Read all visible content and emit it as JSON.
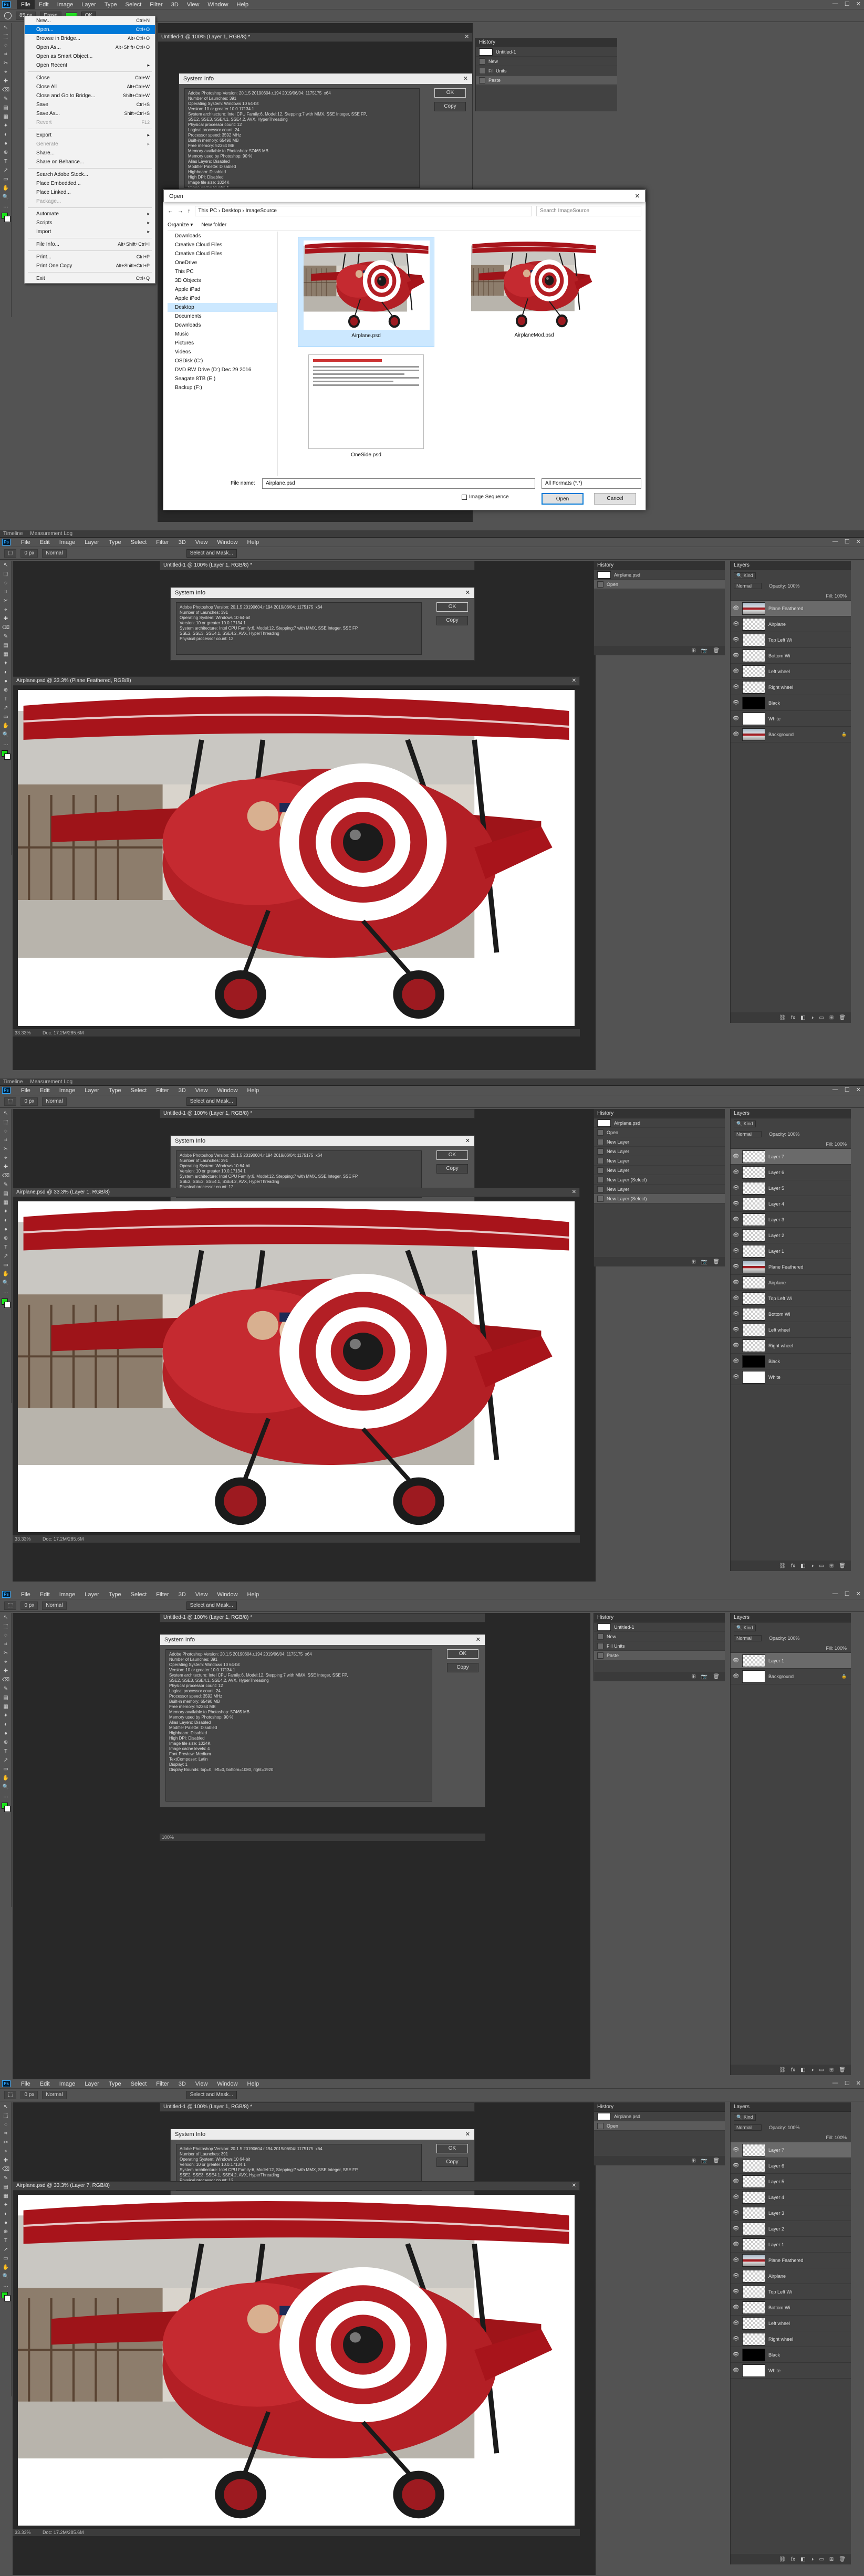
{
  "app": {
    "menu": [
      "File",
      "Edit",
      "Image",
      "Layer",
      "Type",
      "Select",
      "Filter",
      "3D",
      "View",
      "Window",
      "Help"
    ],
    "window_controls": [
      "—",
      "☐",
      "✕"
    ],
    "logo": "Ps"
  },
  "separator_tabs": [
    "Timeline",
    "Measurement Log"
  ],
  "panel1": {
    "options": {
      "zoom": "85 px",
      "mode": "Erase",
      "ok": "OK"
    },
    "doc_tab": "Untitled-1 @ 100% (Layer 1, RGB/8) *",
    "file_menu": [
      {
        "label": "New...",
        "shortcut": "Ctrl+N"
      },
      {
        "label": "Open...",
        "shortcut": "Ctrl+O",
        "hl": true
      },
      {
        "label": "Browse in Bridge...",
        "shortcut": "Alt+Ctrl+O"
      },
      {
        "label": "Open As...",
        "shortcut": "Alt+Shift+Ctrl+O"
      },
      {
        "label": "Open as Smart Object...",
        "shortcut": ""
      },
      {
        "label": "Open Recent",
        "shortcut": "▸"
      },
      {
        "sep": true
      },
      {
        "label": "Close",
        "shortcut": "Ctrl+W"
      },
      {
        "label": "Close All",
        "shortcut": "Alt+Ctrl+W"
      },
      {
        "label": "Close and Go to Bridge...",
        "shortcut": "Shift+Ctrl+W"
      },
      {
        "label": "Save",
        "shortcut": "Ctrl+S"
      },
      {
        "label": "Save As...",
        "shortcut": "Shift+Ctrl+S"
      },
      {
        "label": "Revert",
        "shortcut": "F12",
        "dis": true
      },
      {
        "sep": true
      },
      {
        "label": "Export",
        "shortcut": "▸"
      },
      {
        "label": "Generate",
        "shortcut": "▸",
        "dis": true
      },
      {
        "label": "Share...",
        "shortcut": ""
      },
      {
        "label": "Share on Behance...",
        "shortcut": ""
      },
      {
        "sep": true
      },
      {
        "label": "Search Adobe Stock...",
        "shortcut": ""
      },
      {
        "label": "Place Embedded...",
        "shortcut": ""
      },
      {
        "label": "Place Linked...",
        "shortcut": ""
      },
      {
        "label": "Package...",
        "shortcut": "",
        "dis": true
      },
      {
        "sep": true
      },
      {
        "label": "Automate",
        "shortcut": "▸"
      },
      {
        "label": "Scripts",
        "shortcut": "▸"
      },
      {
        "label": "Import",
        "shortcut": "▸"
      },
      {
        "sep": true
      },
      {
        "label": "File Info...",
        "shortcut": "Alt+Shift+Ctrl+I"
      },
      {
        "sep": true
      },
      {
        "label": "Print...",
        "shortcut": "Ctrl+P"
      },
      {
        "label": "Print One Copy",
        "shortcut": "Alt+Shift+Ctrl+P"
      },
      {
        "sep": true
      },
      {
        "label": "Exit",
        "shortcut": "Ctrl+Q"
      }
    ],
    "history": {
      "header": "History",
      "rows": [
        "Untitled-1",
        "New",
        "Fill Units",
        "Paste"
      ]
    },
    "open_dialog": {
      "title": "Open",
      "path": "This PC  ›  Desktop  ›  ImageSource",
      "search": "Search ImageSource",
      "organize": "Organize ▾",
      "new_folder": "New folder",
      "nav": [
        "Downloads",
        "Creative Cloud Files",
        "Creative Cloud Files",
        "OneDrive",
        "This PC",
        "3D Objects",
        "Apple iPad",
        "Apple iPod",
        "Desktop",
        "Documents",
        "Downloads",
        "Music",
        "Pictures",
        "Videos",
        "OSDisk (C:)",
        "DVD RW Drive (D:) Dec 29 2016",
        "Seagate 8TB (E:)",
        "Backup (F:)"
      ],
      "nav_selected": 8,
      "files": [
        "Airplane.psd",
        "AirplaneMod.psd",
        "OneSide.psd"
      ],
      "file_name_label": "File name:",
      "file_name_value": "Airplane.psd",
      "format": "All Formats (*.*)",
      "image_sequence": "Image Sequence",
      "open_btn": "Open",
      "cancel_btn": "Cancel"
    }
  },
  "sysinfo": {
    "title": "System Info",
    "ok": "OK",
    "copy": "Copy",
    "text": "Adobe Photoshop Version: 20.1.5 20190604.r.194 2019/06/04: 1175175  x64\nNumber of Launches: 391\nOperating System: Windows 10 64-bit\nVersion: 10 or greater 10.0.17134.1\nSystem architecture: Intel CPU Family:6, Model:12, Stepping:7 with MMX, SSE Integer, SSE FP,\nSSE2, SSE3, SSE4.1, SSE4.2, AVX, HyperThreading\nPhysical processor count: 12\nLogical processor count: 24\nProcessor speed: 3592 MHz\nBuilt-in memory: 65490 MB\nFree memory: 52354 MB\nMemory available to Photoshop: 57465 MB\nMemory used by Photoshop: 90 %\nAlias Layers: Disabled\nModifier Palette: Disabled\nHighbeam: Disabled\nHigh DPI: Disabled\nImage tile size: 1024K\nImage cache levels: 4\nFont Preview: Medium\nTextComposer: Latin\nDisplay: 1\nDisplay Bounds: top=0, left=0, bottom=1080, right=1920",
    "zoom": "100%"
  },
  "panel2": {
    "options": {
      "feather": "0 px",
      "style": "Normal",
      "select_mask": "Select and Mask..."
    },
    "doc_tab": "Airplane.psd @ 33.3% (Plane Feathered, RGB/8)",
    "status_zoom": "33.33%",
    "status_doc": "Doc: 17.2M/285.6M",
    "history": {
      "header": "History",
      "doc": "Airplane.psd",
      "rows": [
        "Open"
      ]
    },
    "layers": {
      "header": "Layers",
      "kind": "Kind",
      "blend": "Normal",
      "opacity": "Opacity: 100%",
      "fill": "Fill: 100%",
      "rows": [
        {
          "name": "Plane Feathered",
          "thumb": "photo",
          "sel": true
        },
        {
          "name": "Airplane",
          "thumb": "trans"
        },
        {
          "name": "Top Left Wi",
          "thumb": "trans"
        },
        {
          "name": "Bottom Wi",
          "thumb": "trans"
        },
        {
          "name": "Left wheel",
          "thumb": "trans"
        },
        {
          "name": "Right wheel",
          "thumb": "trans"
        },
        {
          "name": "Black",
          "thumb": "black"
        },
        {
          "name": "White",
          "thumb": "white"
        },
        {
          "name": "Background",
          "thumb": "photo"
        }
      ]
    }
  },
  "panel3": {
    "doc_tab": "Airplane.psd @ 33.3% (Layer 1, RGB/8)",
    "status_zoom": "33.33%",
    "status_doc": "Doc: 17.2M/285.6M",
    "history": {
      "header": "History",
      "doc": "Airplane.psd",
      "rows": [
        "Open",
        "New Layer",
        "New Layer",
        "New Layer",
        "New Layer",
        "New Layer (Select)",
        "New Layer",
        "New Layer (Select)"
      ]
    },
    "layers": {
      "header": "Layers",
      "rows": [
        {
          "name": "Layer 7",
          "thumb": "trans",
          "sel": true
        },
        {
          "name": "Layer 6",
          "thumb": "trans"
        },
        {
          "name": "Layer 5",
          "thumb": "trans"
        },
        {
          "name": "Layer 4",
          "thumb": "trans"
        },
        {
          "name": "Layer 3",
          "thumb": "trans"
        },
        {
          "name": "Layer 2",
          "thumb": "trans"
        },
        {
          "name": "Layer 1",
          "thumb": "trans"
        },
        {
          "name": "Plane Feathered",
          "thumb": "photo"
        },
        {
          "name": "Airplane",
          "thumb": "trans"
        },
        {
          "name": "Top Left Wi",
          "thumb": "trans"
        },
        {
          "name": "Bottom Wi",
          "thumb": "trans"
        },
        {
          "name": "Left wheel",
          "thumb": "trans"
        },
        {
          "name": "Right wheel",
          "thumb": "trans"
        },
        {
          "name": "Black",
          "thumb": "black"
        },
        {
          "name": "White",
          "thumb": "white"
        }
      ]
    }
  },
  "panel4": {
    "history": {
      "header": "History",
      "doc": "Untitled-1",
      "rows": [
        "New",
        "Fill Units",
        "Paste"
      ]
    },
    "layers": {
      "header": "Layers",
      "rows": [
        {
          "name": "Layer 1",
          "thumb": "trans",
          "sel": true
        },
        {
          "name": "Background",
          "thumb": "white"
        }
      ]
    }
  },
  "panel5": {
    "doc_tab": "Airplane.psd @ 33.3% (Layer 7, RGB/8)",
    "status_zoom": "33.33%",
    "status_doc": "Doc: 17.2M/285.6M",
    "history": {
      "header": "History",
      "doc": "Airplane.psd",
      "rows": [
        "Open"
      ]
    },
    "layers": {
      "header": "Layers",
      "rows": [
        {
          "name": "Layer 7",
          "thumb": "trans",
          "sel": true
        },
        {
          "name": "Layer 6",
          "thumb": "trans"
        },
        {
          "name": "Layer 5",
          "thumb": "trans"
        },
        {
          "name": "Layer 4",
          "thumb": "trans"
        },
        {
          "name": "Layer 3",
          "thumb": "trans"
        },
        {
          "name": "Layer 2",
          "thumb": "trans"
        },
        {
          "name": "Layer 1",
          "thumb": "trans"
        },
        {
          "name": "Plane Feathered",
          "thumb": "photo"
        },
        {
          "name": "Airplane",
          "thumb": "trans"
        },
        {
          "name": "Top Left Wi",
          "thumb": "trans"
        },
        {
          "name": "Bottom Wi",
          "thumb": "trans"
        },
        {
          "name": "Left wheel",
          "thumb": "trans"
        },
        {
          "name": "Right wheel",
          "thumb": "trans"
        },
        {
          "name": "Black",
          "thumb": "black"
        },
        {
          "name": "White",
          "thumb": "white"
        }
      ]
    }
  },
  "colors": {
    "accent": "#31a8ff",
    "foreground_swatch": "#18e018",
    "plane_red": "#b31f25"
  }
}
